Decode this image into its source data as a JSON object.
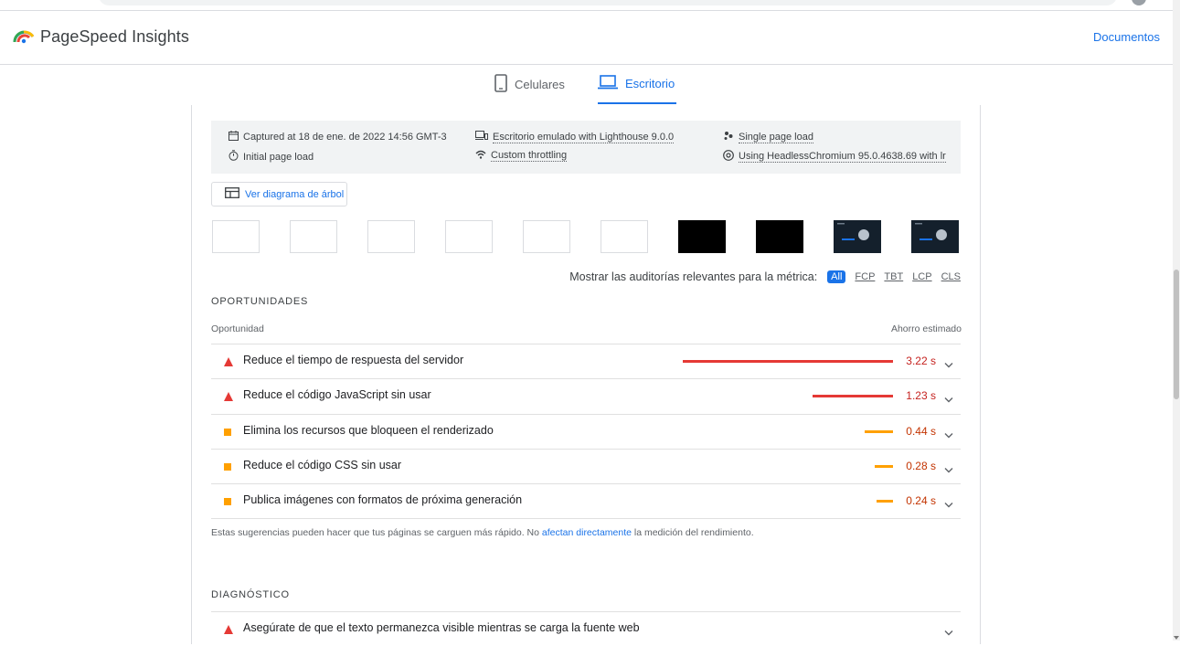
{
  "header": {
    "brand": "PageSpeed Insights",
    "docs_link": "Documentos"
  },
  "tabs": [
    {
      "label": "Celulares",
      "icon": "smartphone-icon",
      "active": false
    },
    {
      "label": "Escritorio",
      "icon": "laptop-icon",
      "active": true
    }
  ],
  "environment": {
    "captured": "Captured at 18 de ene. de 2022 14:56 GMT-3",
    "initial_load": "Initial page load",
    "emulated": "Escritorio emulado with Lighthouse 9.0.0",
    "throttling": "Custom throttling",
    "single_load": "Single page load",
    "browser": "Using HeadlessChromium 95.0.4638.69 with lr"
  },
  "tree_button": "Ver diagrama de árbol",
  "filmstrip": [
    "blank",
    "blank",
    "blank",
    "blank",
    "blank",
    "blank",
    "black",
    "black",
    "dark",
    "dark"
  ],
  "filter": {
    "label": "Mostrar las auditorías relevantes para la métrica:",
    "chips": [
      "All",
      "FCP",
      "TBT",
      "LCP",
      "CLS"
    ],
    "active": "All"
  },
  "opportunities": {
    "title": "OPORTUNIDADES",
    "col_left": "Oportunidad",
    "col_right": "Ahorro estimado",
    "items": [
      {
        "title": "Reduce el tiempo de respuesta del servidor",
        "savings": "3.22 s",
        "severity": "fail",
        "fraction": 1.0
      },
      {
        "title": "Reduce el código JavaScript sin usar",
        "savings": "1.23 s",
        "severity": "fail",
        "fraction": 0.382
      },
      {
        "title": "Elimina los recursos que bloqueen el renderizado",
        "savings": "0.44 s",
        "severity": "average",
        "fraction": 0.135
      },
      {
        "title": "Reduce el código CSS sin usar",
        "savings": "0.28 s",
        "severity": "average",
        "fraction": 0.087
      },
      {
        "title": "Publica imágenes con formatos de próxima generación",
        "savings": "0.24 s",
        "severity": "average",
        "fraction": 0.074
      }
    ],
    "note_before": "Estas sugerencias pueden hacer que tus páginas se carguen más rápido. No ",
    "note_link": "afectan directamente",
    "note_after": " la medición del rendimiento."
  },
  "diagnostics": {
    "title": "DIAGNÓSTICO",
    "items": [
      {
        "title": "Asegúrate de que el texto permanezca visible mientras se carga la fuente web",
        "severity": "fail"
      }
    ]
  },
  "colors": {
    "accent": "#1a73e8",
    "fail": "#e53935",
    "average": "#ffa000",
    "fail_text": "#c5221f",
    "average_text": "#c33300"
  }
}
